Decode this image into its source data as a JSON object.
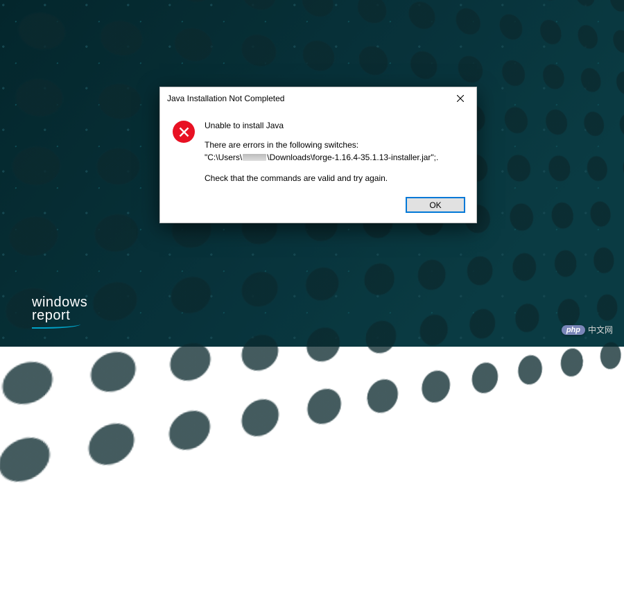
{
  "dialog": {
    "title": "Java Installation Not Completed",
    "heading": "Unable to install Java",
    "errors_intro": "There are errors in the following switches:",
    "path_prefix": "\"C:\\Users\\",
    "path_suffix": "\\Downloads\\forge-1.16.4-35.1.13-installer.jar\";.",
    "check_text": "Check that the commands are valid and try again.",
    "ok_label": "OK"
  },
  "branding": {
    "logo_line1": "windows",
    "logo_line2": "report",
    "php_label": "php",
    "php_text": "中文网"
  }
}
